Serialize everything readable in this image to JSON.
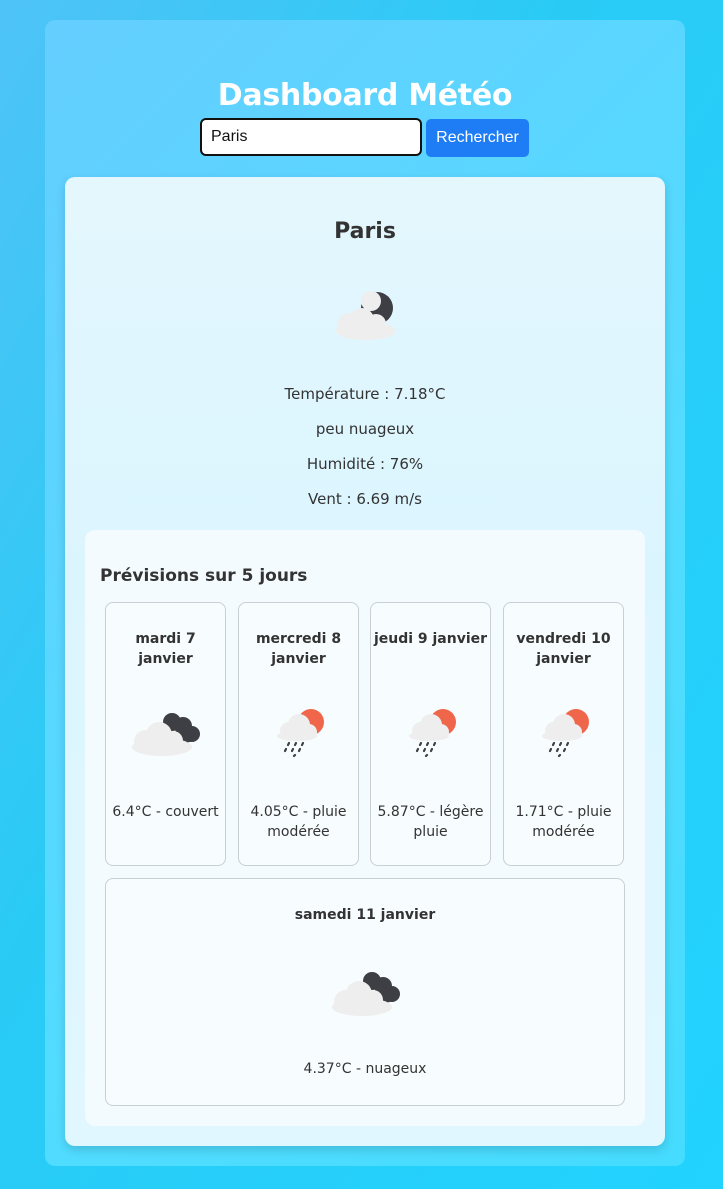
{
  "header": {
    "title": "Dashboard Météo"
  },
  "search": {
    "value": "Paris",
    "button_label": "Rechercher"
  },
  "current": {
    "city": "Paris",
    "icon": "partly-cloudy-night-icon",
    "temperature": "Température : 7.18°C",
    "description": "peu nuageux",
    "humidity": "Humidité : 76%",
    "wind": "Vent : 6.69 m/s"
  },
  "forecast": {
    "title": "Prévisions sur 5 jours",
    "days": [
      {
        "name": "mardi 7 janvier",
        "icon": "overcast-clouds-icon",
        "text": "6.4°C - couvert"
      },
      {
        "name": "mercredi 8 janvier",
        "icon": "rain-sun-icon",
        "text": "4.05°C - pluie modérée"
      },
      {
        "name": "jeudi 9 janvier",
        "icon": "rain-sun-icon",
        "text": "5.87°C - légère pluie"
      },
      {
        "name": "vendredi 10 janvier",
        "icon": "rain-sun-icon",
        "text": "1.71°C - pluie modérée"
      },
      {
        "name": "samedi 11 janvier",
        "icon": "broken-clouds-icon",
        "text": "4.37°C - nuageux"
      }
    ]
  },
  "colors": {
    "accent": "#1e7df5",
    "sun": "#f0664a",
    "dark_cloud": "#3e3f44",
    "light_cloud": "#eeeeee"
  }
}
